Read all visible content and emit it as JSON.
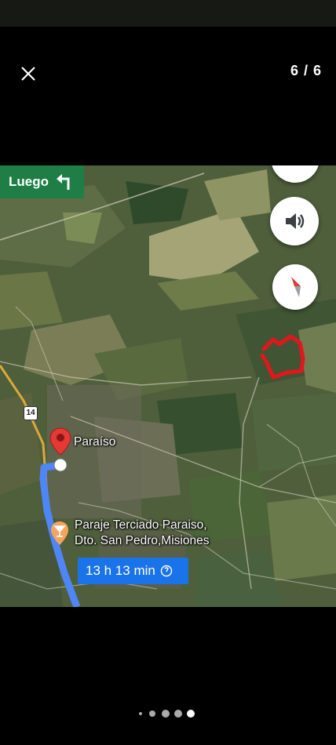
{
  "viewer": {
    "counter": "6 / 6",
    "close_icon": "close-icon",
    "page_indicator": {
      "total": 5,
      "active_index": 4
    }
  },
  "map": {
    "next_turn": {
      "label": "Luego",
      "icon": "turn-left-icon",
      "color": "#1e7e45"
    },
    "buttons": {
      "sound_icon": "volume-icon",
      "compass_icon": "compass-icon"
    },
    "route_shield": "14",
    "destination_pin": {
      "label": "Paraíso",
      "color": "#e53935"
    },
    "poi": {
      "line1": "Paraje Terciado Paraiso,",
      "line2": "Dto. San Pedro,Misiones",
      "icon": "drink-icon"
    },
    "eta": {
      "label": "13 h 13 min",
      "icon": "info-icon",
      "color": "#1a73e8"
    },
    "route_color": "#4f86f7",
    "annotation_color": "#e8141b"
  }
}
